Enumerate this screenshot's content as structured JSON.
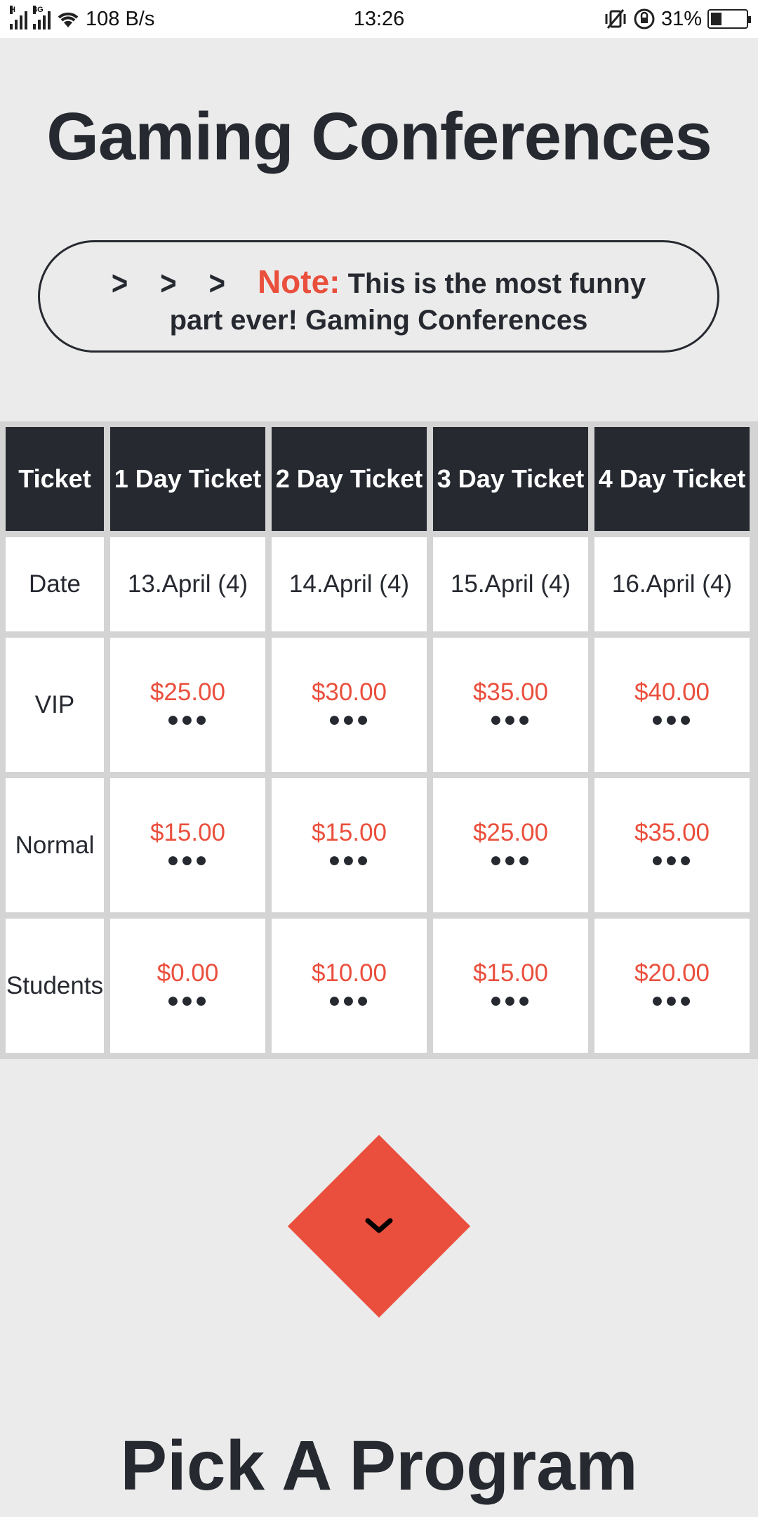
{
  "status_bar": {
    "network_speed": "108 B/s",
    "time": "13:26",
    "battery": "31%",
    "network_tag_1": "H",
    "network_tag_2": "3G"
  },
  "title": "Gaming Conferences",
  "note": {
    "chevrons": [
      ">",
      ">",
      ">"
    ],
    "label": "Note:",
    "text": "This is the most funny part ever! Gaming Conferences"
  },
  "table": {
    "headers": [
      "Ticket",
      "1 Day Ticket",
      "2 Day Ticket",
      "3 Day Ticket",
      "4 Day Ticket"
    ],
    "date_row": {
      "label": "Date",
      "values": [
        "13.April (4)",
        "14.April (4)",
        "15.April (4)",
        "16.April (4)"
      ]
    },
    "price_rows": [
      {
        "label": "VIP",
        "prices": [
          "$25.00",
          "$30.00",
          "$35.00",
          "$40.00"
        ]
      },
      {
        "label": "Normal",
        "prices": [
          "$15.00",
          "$15.00",
          "$25.00",
          "$35.00"
        ]
      },
      {
        "label": "Students",
        "prices": [
          "$0.00",
          "$10.00",
          "$15.00",
          "$20.00"
        ]
      }
    ],
    "dots": "●●●"
  },
  "scroll_button_icon": "chevron-down-icon",
  "section_title": "Pick A Program",
  "colors": {
    "accent": "#ea4f3d",
    "dark": "#262930",
    "background": "#ebebeb"
  }
}
